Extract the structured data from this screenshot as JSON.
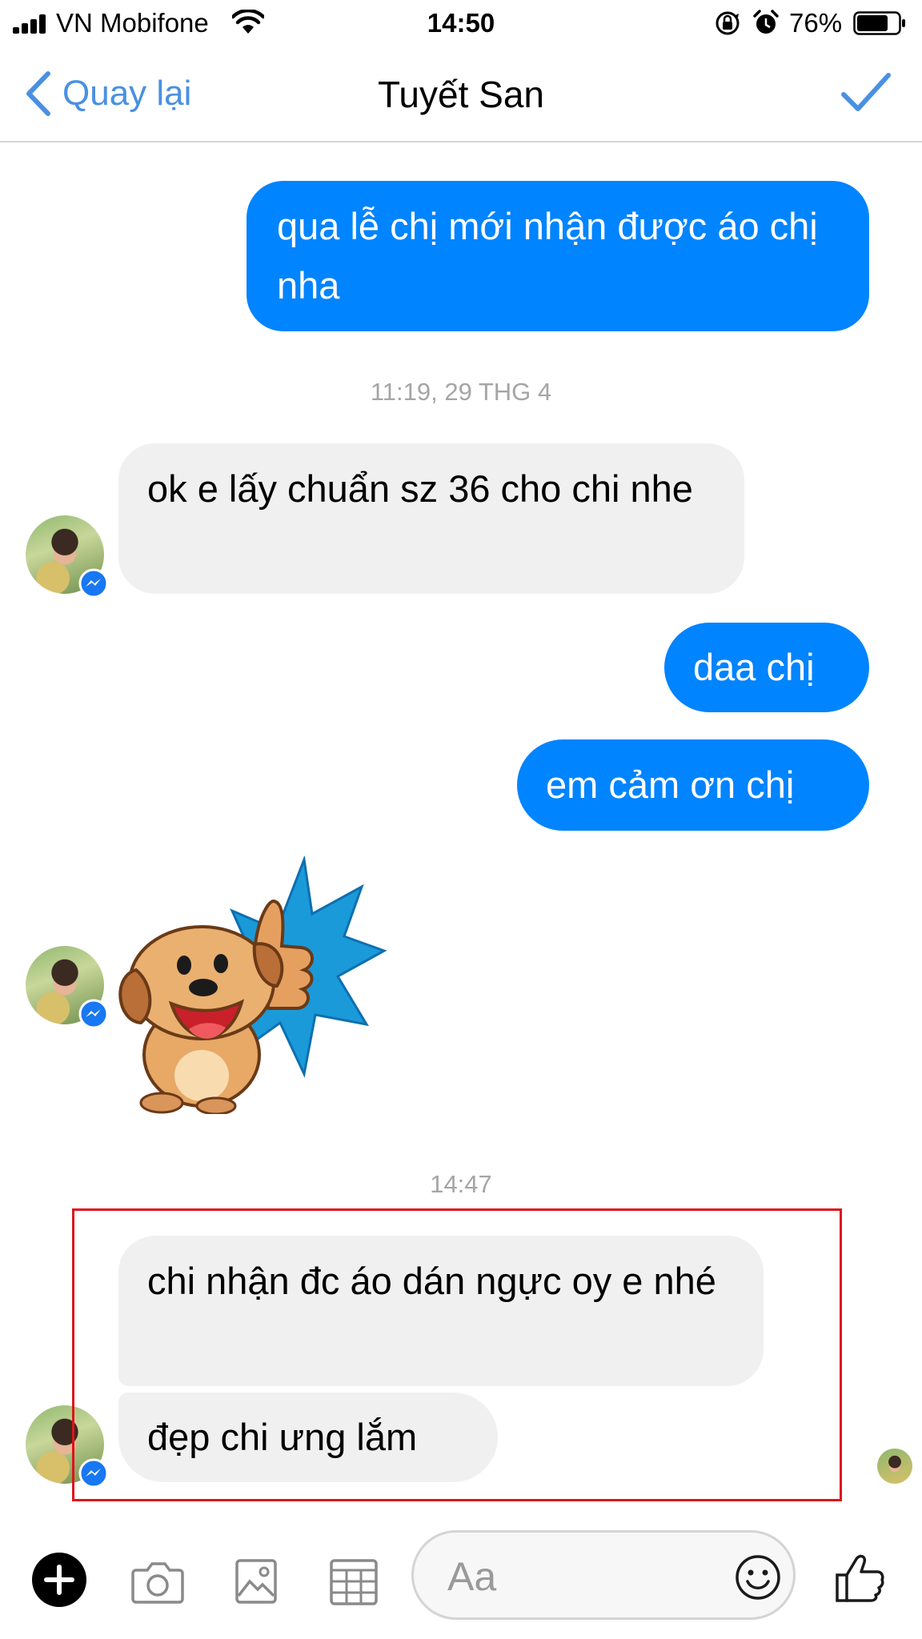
{
  "status_bar": {
    "carrier": "VN Mobifone",
    "time": "14:50",
    "battery_percent": "76%",
    "battery_level": 0.76,
    "icons": [
      "signal-icon",
      "wifi-icon",
      "rotation-lock-icon",
      "alarm-icon",
      "battery-icon"
    ]
  },
  "nav": {
    "back_label": "Quay lại",
    "title": "Tuyết San",
    "icons": [
      "chevron-left-icon",
      "checkmark-icon"
    ]
  },
  "messages": [
    {
      "sender": "me",
      "text": "qua lễ chị mới nhận được áo chị nha"
    },
    {
      "type": "timestamp",
      "text": "11:19, 29 THG 4"
    },
    {
      "sender": "them",
      "text": "ok e lấy chuẩn sz 36 cho chi nhe"
    },
    {
      "sender": "me",
      "text": "daa chị"
    },
    {
      "sender": "me",
      "text": "em cảm ơn chị"
    },
    {
      "sender": "them",
      "type": "sticker",
      "sticker": "thumbs-up-dog-sticker"
    },
    {
      "type": "timestamp",
      "text": "14:47"
    },
    {
      "sender": "them",
      "text": "chi nhận đc áo dán ngực oy e nhé"
    },
    {
      "sender": "them",
      "text": "đẹp chi ưng lắm"
    }
  ],
  "composer": {
    "placeholder": "Aa",
    "icons": [
      "plus-icon",
      "camera-icon",
      "image-icon",
      "grid-icon",
      "emoji-icon",
      "like-icon"
    ]
  },
  "colors": {
    "outgoing_bubble": "#0084ff",
    "incoming_bubble": "#f0f0f0",
    "accent": "#4a90e2",
    "highlight_box": "#e0131b"
  }
}
